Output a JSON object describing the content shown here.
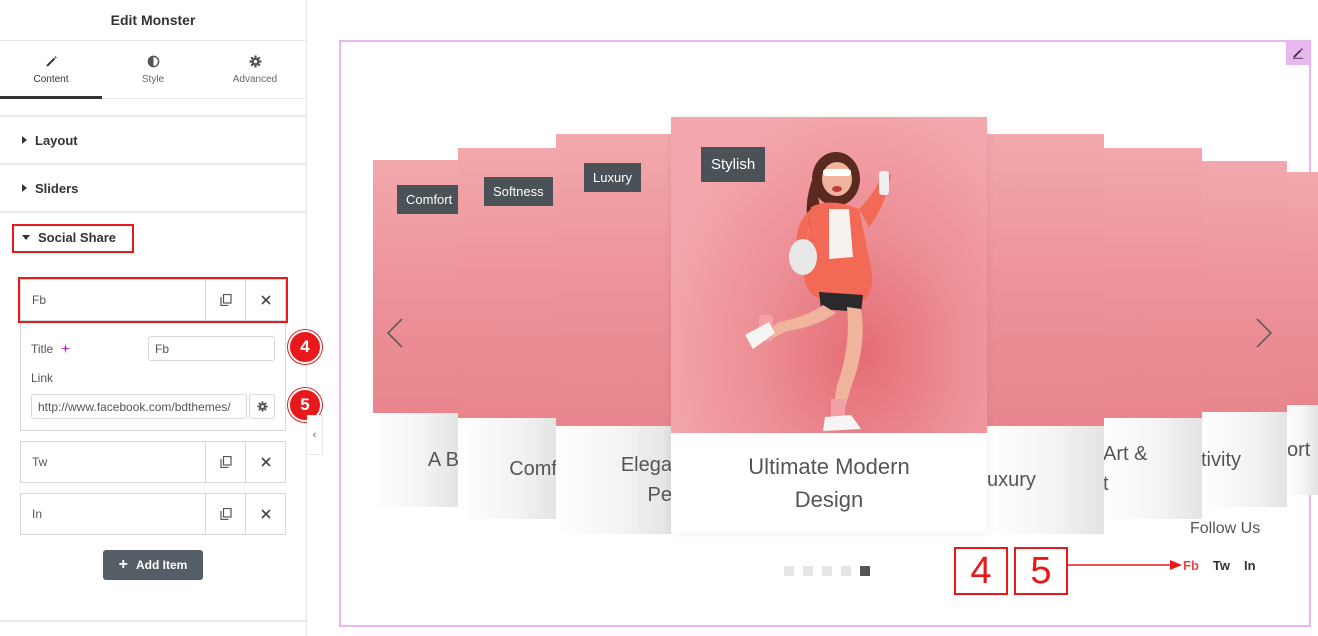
{
  "panel": {
    "title": "Edit Monster",
    "tabs": [
      {
        "label": "Content",
        "icon": "pencil-icon"
      },
      {
        "label": "Style",
        "icon": "half-circle-icon"
      },
      {
        "label": "Advanced",
        "icon": "gear-icon"
      }
    ],
    "sections": {
      "layout": "Layout",
      "sliders": "Sliders",
      "social_share": "Social Share"
    },
    "items": [
      {
        "title": "Fb"
      },
      {
        "title": "Tw"
      },
      {
        "title": "In"
      }
    ],
    "fields": {
      "title_label": "Title",
      "title_value": "Fb",
      "link_label": "Link",
      "link_value": "http://www.facebook.com/bdthemes/"
    },
    "add_item_label": "Add Item",
    "badges": [
      "4",
      "5"
    ]
  },
  "slider": {
    "cards": [
      {
        "tag": "Comfort",
        "caption": "A B"
      },
      {
        "tag": "Softness",
        "caption": "Comf"
      },
      {
        "tag": "Luxury",
        "caption": "Elega\nPe"
      },
      {
        "tag": "Stylish",
        "caption": "Ultimate Modern\nDesign"
      },
      {
        "tag": "",
        "caption": "uxury"
      },
      {
        "tag": "",
        "caption": "Art &\nt"
      },
      {
        "tag": "",
        "caption": "tivity"
      },
      {
        "tag": "",
        "caption": "ort"
      }
    ],
    "dots": 5,
    "active_dot": 4,
    "follow_label": "Follow Us",
    "share_links": [
      "Fb",
      "Tw",
      "In"
    ],
    "active_link": "Fb",
    "annotations": [
      "4",
      "5"
    ]
  },
  "colors": {
    "highlight": "#e8181b",
    "preview_border": "#e8b7f0",
    "tag_bg": "#4a5257",
    "active_link": "#e84548"
  }
}
